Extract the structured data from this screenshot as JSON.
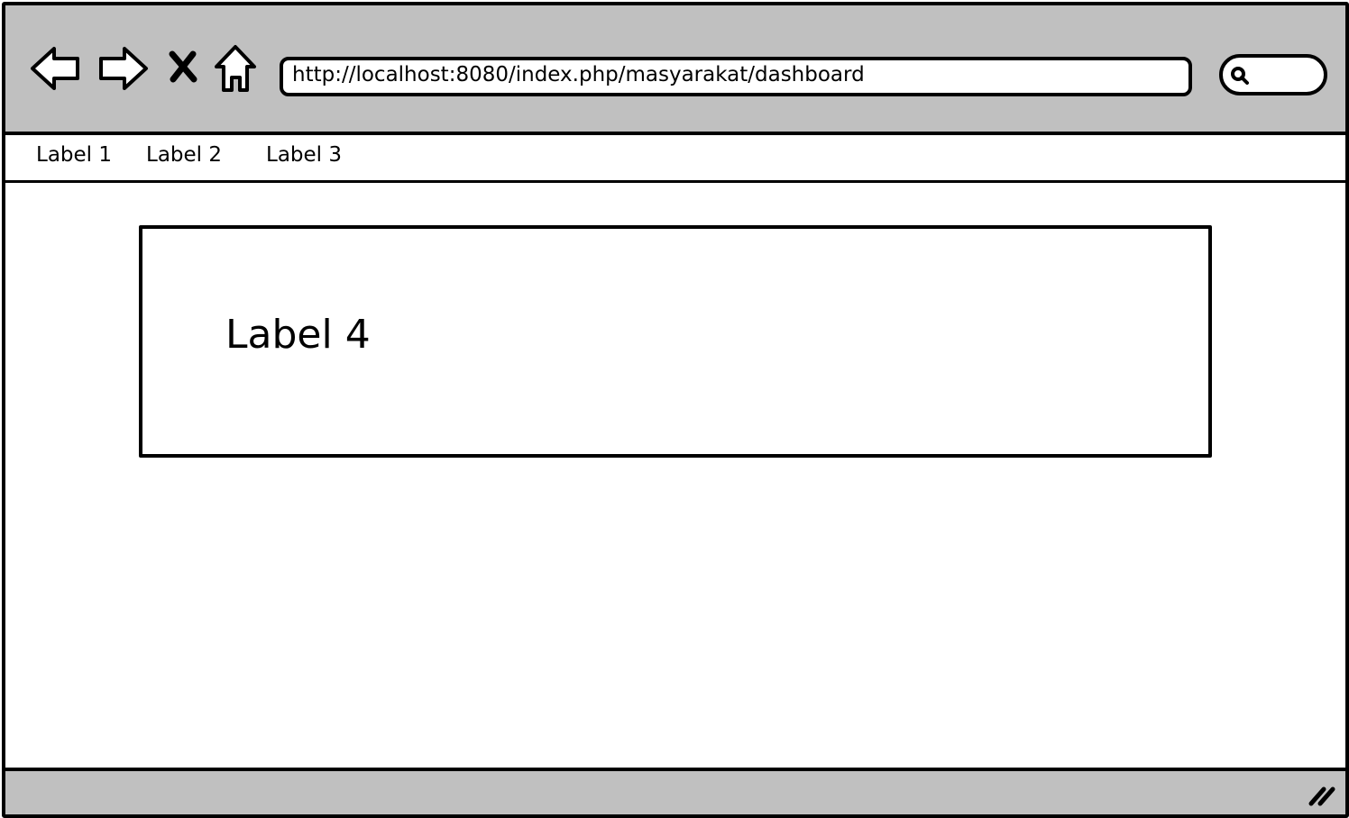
{
  "toolbar": {
    "back_icon": "back-arrow-icon",
    "forward_icon": "forward-arrow-icon",
    "stop_icon": "close-x-icon",
    "home_icon": "home-icon"
  },
  "address_bar": {
    "url": "http://localhost:8080/index.php/masyarakat/dashboard"
  },
  "search": {
    "icon": "search-icon",
    "value": ""
  },
  "menu": {
    "items": [
      {
        "label": "Label 1"
      },
      {
        "label": "Label 2"
      },
      {
        "label": "Label 3"
      }
    ]
  },
  "content": {
    "panel_label": "Label 4"
  },
  "statusbar": {
    "grip_icon": "resize-grip-icon"
  },
  "colors": {
    "chrome": "#c0c0c0",
    "stroke": "#000000",
    "background": "#ffffff"
  }
}
